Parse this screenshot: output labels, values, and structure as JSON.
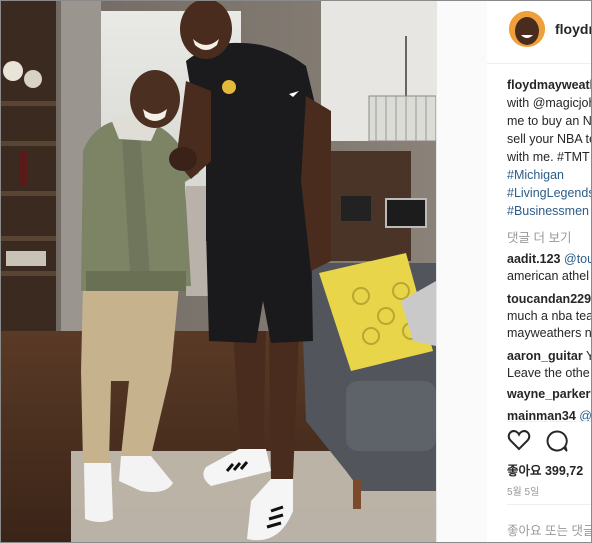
{
  "post": {
    "username": "floydmayweather",
    "caption_username": "floydmayweather",
    "caption_lines": [
      "with @magicjohnson",
      "me to buy an NBA",
      "sell your NBA team",
      "with me. #TMT",
      "#Michigan",
      "#LivingLegends",
      "#Businessmen"
    ],
    "view_more_label": "댓글 더 보기",
    "comments": [
      {
        "user": "aadit.123",
        "text": "@tou",
        "continuation": "american athel"
      },
      {
        "user": "toucandan229",
        "text": "",
        "continuation": "much a nba tea"
      },
      {
        "user": "",
        "text": "",
        "continuation": "mayweathers n"
      },
      {
        "user": "aaron_guitar",
        "text": "Y",
        "continuation": "Leave the othe"
      },
      {
        "user": "wayne_parker9",
        "text": "",
        "continuation": ""
      },
      {
        "user": "mainman34",
        "text": "@",
        "continuation": ""
      }
    ],
    "likes_label": "좋아요 399,72",
    "date_label": "5월 5일",
    "comment_placeholder": "좋아요 또는 댓글"
  },
  "colors": {
    "link": "#2b5d8a",
    "text": "#262626",
    "muted": "#999999",
    "avatar_bg": "#f0a03a"
  },
  "icons": [
    "heart-icon",
    "comment-bubble-icon"
  ]
}
